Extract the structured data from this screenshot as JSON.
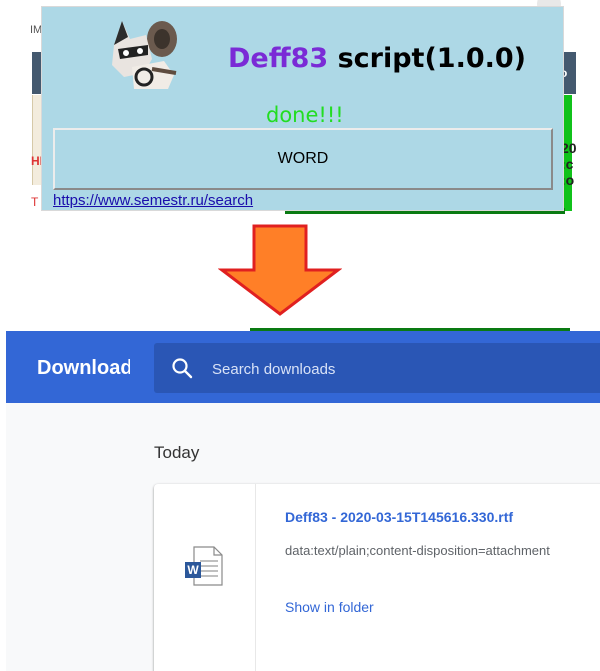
{
  "background": {
    "fragments": {
      "top_left": "IM",
      "mid_left": "HI",
      "bottom_left": "T",
      "top_right": "o",
      "mid_right": "20\n:c\n:o"
    }
  },
  "popup": {
    "title_brand": "Deff83",
    "title_rest": "script(1.0.0)",
    "status": "done!!!",
    "button_label": "WORD",
    "link": "https://www.semestr.ru/search",
    "avatar_icon": "raccoon-avatar-icon",
    "colors": {
      "background": "#add8e6",
      "brand": "#7a2bd6",
      "status": "#22dd22"
    }
  },
  "arrow": {
    "icon": "down-arrow-icon",
    "fill": "#ff7f27",
    "stroke": "#e02020"
  },
  "downloads": {
    "title": "Downloads",
    "search_placeholder": "Search downloads",
    "date_group": "Today",
    "items": [
      {
        "file_name": "Deff83 - 2020-03-15T145616.330.rtf",
        "url": "data:text/plain;content-disposition=attachment",
        "action": "Show in folder",
        "icon": "word-document-icon"
      }
    ],
    "colors": {
      "header": "#3367d6",
      "search_box": "#2a56b5",
      "link": "#3367d6"
    }
  }
}
